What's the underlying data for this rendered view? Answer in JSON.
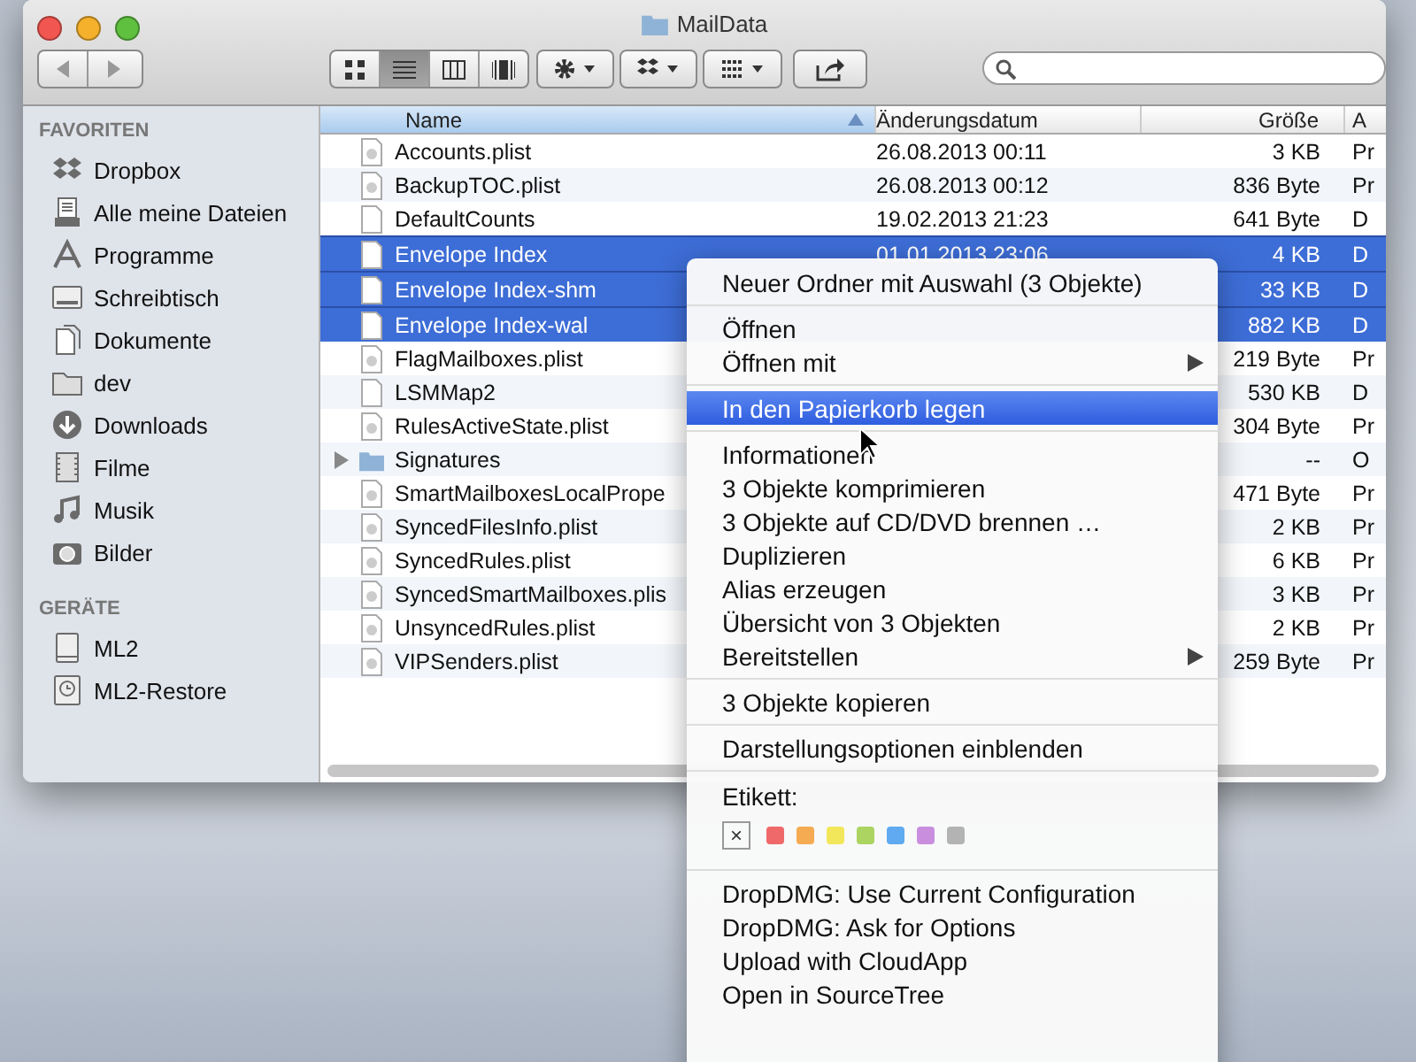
{
  "window": {
    "title": "MailData"
  },
  "toolbar": {
    "view_modes": [
      {
        "kind": "icons",
        "selected": false
      },
      {
        "kind": "list",
        "selected": true
      },
      {
        "kind": "columns",
        "selected": false
      },
      {
        "kind": "coverflow",
        "selected": false
      }
    ]
  },
  "sidebar": {
    "sections": [
      {
        "heading": "FAVORITEN",
        "items": [
          {
            "label": "Dropbox",
            "kind": "dropbox"
          },
          {
            "label": "Alle meine Dateien",
            "kind": "allfiles"
          },
          {
            "label": "Programme",
            "kind": "apps"
          },
          {
            "label": "Schreibtisch",
            "kind": "desktop"
          },
          {
            "label": "Dokumente",
            "kind": "documents"
          },
          {
            "label": "dev",
            "kind": "folder"
          },
          {
            "label": "Downloads",
            "kind": "downloads"
          },
          {
            "label": "Filme",
            "kind": "movies"
          },
          {
            "label": "Musik",
            "kind": "music"
          },
          {
            "label": "Bilder",
            "kind": "pictures"
          }
        ]
      },
      {
        "heading": "GERÄTE",
        "items": [
          {
            "label": "ML2",
            "kind": "disk"
          },
          {
            "label": "ML2-Restore",
            "kind": "timemachine"
          }
        ]
      }
    ]
  },
  "table": {
    "columns": [
      {
        "label": "Name",
        "sorted": true
      },
      {
        "label": "Änderungsdatum",
        "sorted": false
      },
      {
        "label": "Größe",
        "sorted": false
      },
      {
        "label": "A",
        "sorted": false
      }
    ],
    "rows": [
      {
        "name": "Accounts.plist",
        "kind": "plist",
        "selected": false,
        "date": "26.08.2013 00:11",
        "size": "3 KB",
        "column_4": "Pr"
      },
      {
        "name": "BackupTOC.plist",
        "kind": "plist",
        "selected": false,
        "date": "26.08.2013 00:12",
        "size": "836 Byte",
        "column_4": "Pr"
      },
      {
        "name": "DefaultCounts",
        "kind": "file",
        "selected": false,
        "date": "19.02.2013 21:23",
        "size": "641 Byte",
        "column_4": "D"
      },
      {
        "name": "Envelope Index",
        "kind": "file",
        "selected": true,
        "date": "01.01.2013 23:06",
        "size": "4 KB",
        "column_4": "D"
      },
      {
        "name": "Envelope Index-shm",
        "kind": "file",
        "selected": true,
        "size": "33 KB",
        "column_4": "D"
      },
      {
        "name": "Envelope Index-wal",
        "kind": "file",
        "selected": true,
        "size": "882 KB",
        "column_4": "D"
      },
      {
        "name": "FlagMailboxes.plist",
        "kind": "plist",
        "selected": false,
        "size": "219 Byte",
        "column_4": "Pr"
      },
      {
        "name": "LSMMap2",
        "kind": "file",
        "selected": false,
        "size": "530 KB",
        "column_4": "D"
      },
      {
        "name": "RulesActiveState.plist",
        "kind": "plist",
        "selected": false,
        "size": "304 Byte",
        "column_4": "Pr"
      },
      {
        "name": "Signatures",
        "kind": "folder",
        "selected": false,
        "size": "--",
        "column_4": "O"
      },
      {
        "name": "SmartMailboxesLocalPrope",
        "kind": "plist",
        "selected": false,
        "size": "471 Byte",
        "column_4": "Pr"
      },
      {
        "name": "SyncedFilesInfo.plist",
        "kind": "plist",
        "selected": false,
        "size": "2 KB",
        "column_4": "Pr"
      },
      {
        "name": "SyncedRules.plist",
        "kind": "plist",
        "selected": false,
        "size": "6 KB",
        "column_4": "Pr"
      },
      {
        "name": "SyncedSmartMailboxes.plis",
        "kind": "plist",
        "selected": false,
        "size": "3 KB",
        "column_4": "Pr"
      },
      {
        "name": "UnsyncedRules.plist",
        "kind": "plist",
        "selected": false,
        "size": "2 KB",
        "column_4": "Pr"
      },
      {
        "name": "VIPSenders.plist",
        "kind": "plist",
        "selected": false,
        "size": "259 Byte",
        "column_4": "Pr"
      }
    ]
  },
  "context_menu": {
    "sections": [
      {
        "kind": "items",
        "items": [
          {
            "label": "Neuer Ordner mit Auswahl (3 Objekte)",
            "submenu": false,
            "highlighted": false
          }
        ]
      },
      {
        "kind": "items",
        "items": [
          {
            "label": "Öffnen",
            "submenu": false,
            "highlighted": false
          },
          {
            "label": "Öffnen mit",
            "submenu": true,
            "highlighted": false
          }
        ]
      },
      {
        "kind": "items",
        "items": [
          {
            "label": "In den Papierkorb legen",
            "submenu": false,
            "highlighted": true
          }
        ]
      },
      {
        "kind": "items",
        "items": [
          {
            "label": "Informationen",
            "submenu": false,
            "highlighted": false
          },
          {
            "label": "3 Objekte komprimieren",
            "submenu": false,
            "highlighted": false
          },
          {
            "label": "3 Objekte auf CD/DVD brennen …",
            "submenu": false,
            "highlighted": false
          },
          {
            "label": "Duplizieren",
            "submenu": false,
            "highlighted": false
          },
          {
            "label": "Alias erzeugen",
            "submenu": false,
            "highlighted": false
          },
          {
            "label": "Übersicht von 3 Objekten",
            "submenu": false,
            "highlighted": false
          },
          {
            "label": "Bereitstellen",
            "submenu": true,
            "highlighted": false
          }
        ]
      },
      {
        "kind": "items",
        "items": [
          {
            "label": "3 Objekte kopieren",
            "submenu": false,
            "highlighted": false
          }
        ]
      },
      {
        "kind": "items",
        "items": [
          {
            "label": "Darstellungsoptionen einblenden",
            "submenu": false,
            "highlighted": false
          }
        ]
      },
      {
        "kind": "labels",
        "title": "Etikett:",
        "remove": "×",
        "colors": [
          {
            "color": "#f0696a"
          },
          {
            "color": "#f5ab52"
          },
          {
            "color": "#f2e65a"
          },
          {
            "color": "#acd461"
          },
          {
            "color": "#5faaf0"
          },
          {
            "color": "#c98fde"
          },
          {
            "color": "#b3b3b3"
          }
        ]
      },
      {
        "kind": "items",
        "items": [
          {
            "label": "DropDMG: Use Current Configuration",
            "submenu": false,
            "highlighted": false
          },
          {
            "label": "DropDMG: Ask for Options",
            "submenu": false,
            "highlighted": false
          },
          {
            "label": "Upload with CloudApp",
            "submenu": false,
            "highlighted": false
          },
          {
            "label": "Open in SourceTree",
            "submenu": false,
            "highlighted": false
          }
        ]
      }
    ]
  }
}
